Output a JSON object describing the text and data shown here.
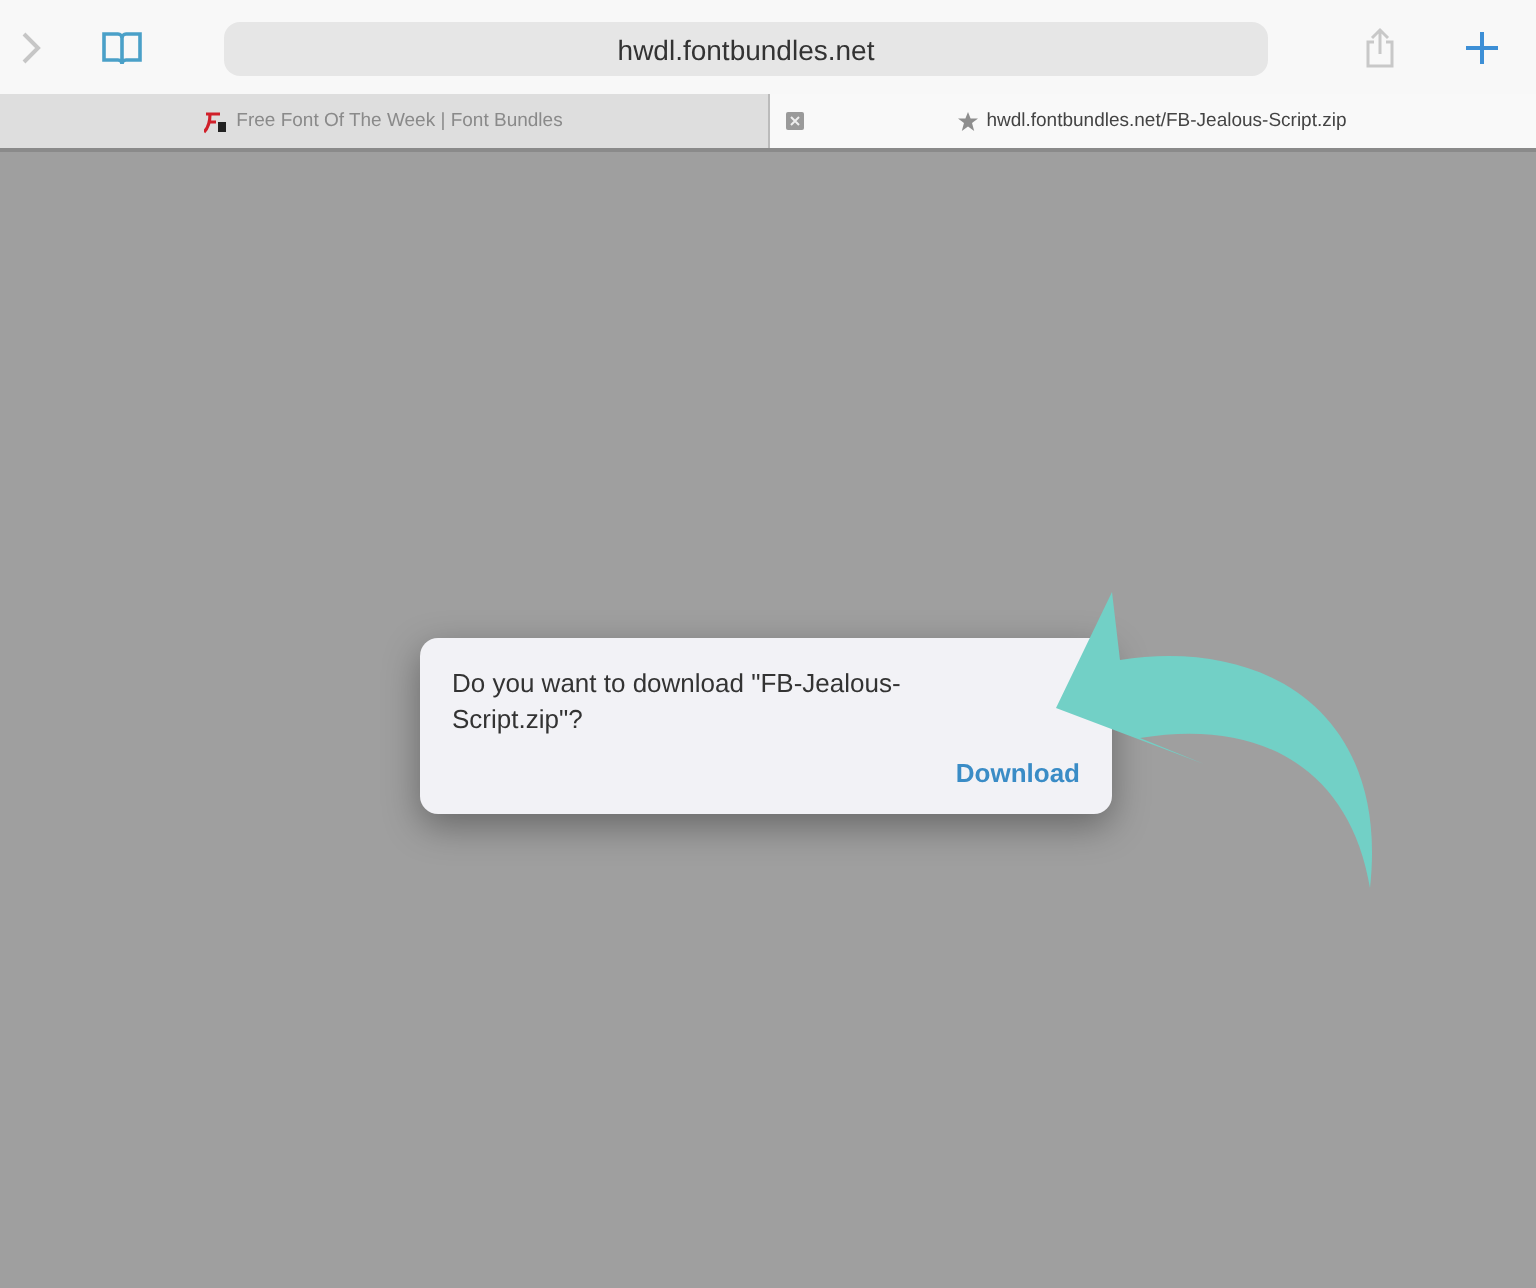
{
  "toolbar": {
    "address": "hwdl.fontbundles.net"
  },
  "tabs": [
    {
      "title": "Free Font Of The Week | Font Bundles",
      "selected": false,
      "kind": "site"
    },
    {
      "title": "hwdl.fontbundles.net/FB-Jealous-Script.zip",
      "selected": true,
      "kind": "download"
    }
  ],
  "dialog": {
    "message": "Do you want to download \"FB-Jealous-Script.zip\"?",
    "button": "Download"
  }
}
